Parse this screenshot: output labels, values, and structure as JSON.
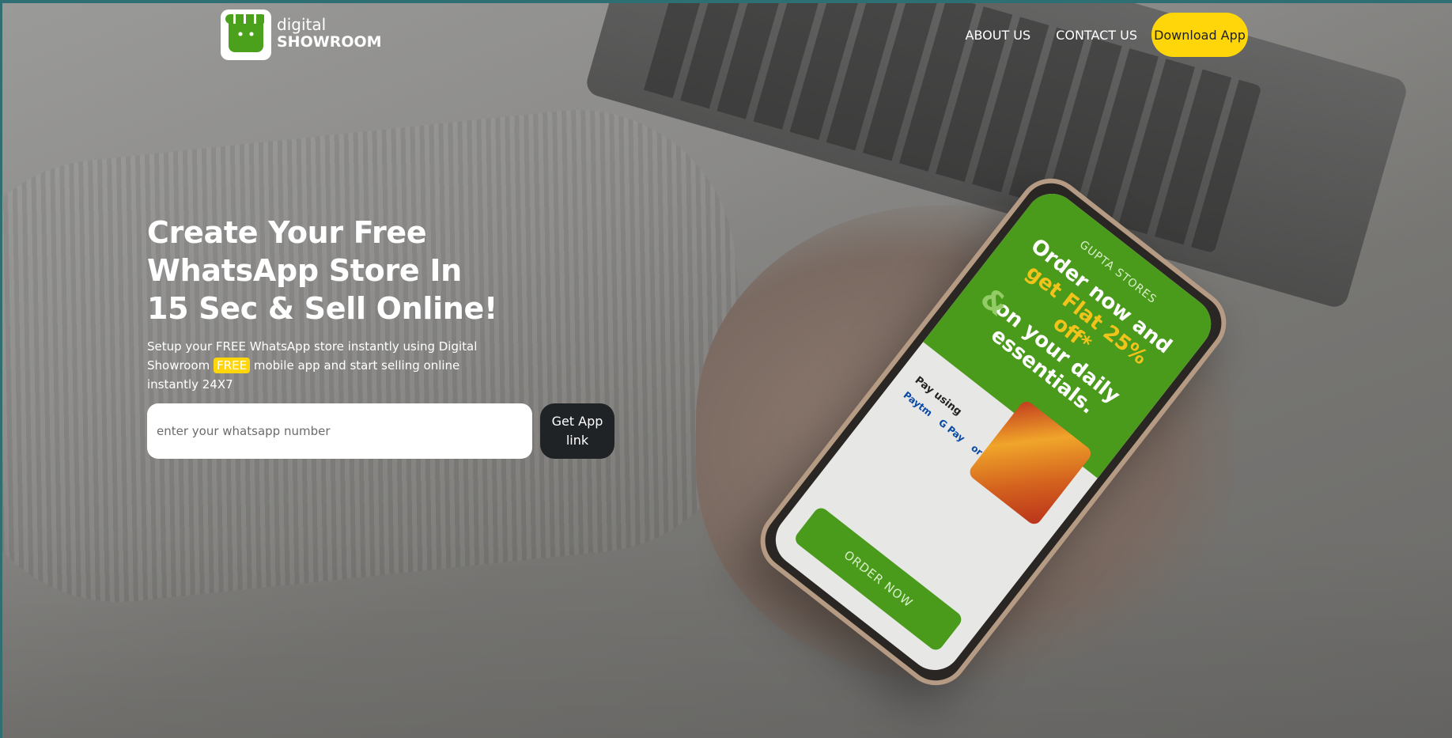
{
  "brand": {
    "line1": "digital",
    "line2": "SHOWROOM"
  },
  "nav": {
    "about": "ABOUT US",
    "contact": "CONTACT US",
    "download": "Download App"
  },
  "hero": {
    "title_line1": "Create Your Free",
    "title_line2": "WhatsApp Store In",
    "title_line3": "15 Sec & Sell Online!",
    "sub_part1": "Setup your FREE WhatsApp store instantly using Digital Showroom ",
    "sub_free": "FREE",
    "sub_part2": " mobile app and start selling online instantly 24X7"
  },
  "form": {
    "placeholder": "enter your whatsapp number",
    "button_label": "Get App link"
  },
  "phone": {
    "store": "GUPTA STORES",
    "promo_1": "Order now and",
    "promo_hl": "get Flat 25% off*",
    "promo_2": "on your daily essentials.",
    "pay_label": "Pay using",
    "pay_1": "Paytm",
    "pay_2": "G Pay",
    "pay_3": "or Cash",
    "order_button": "ORDER NOW"
  },
  "colors": {
    "accent_yellow": "#ffd60a",
    "brand_green": "#4ba01c",
    "dark_button": "#1f2326"
  }
}
